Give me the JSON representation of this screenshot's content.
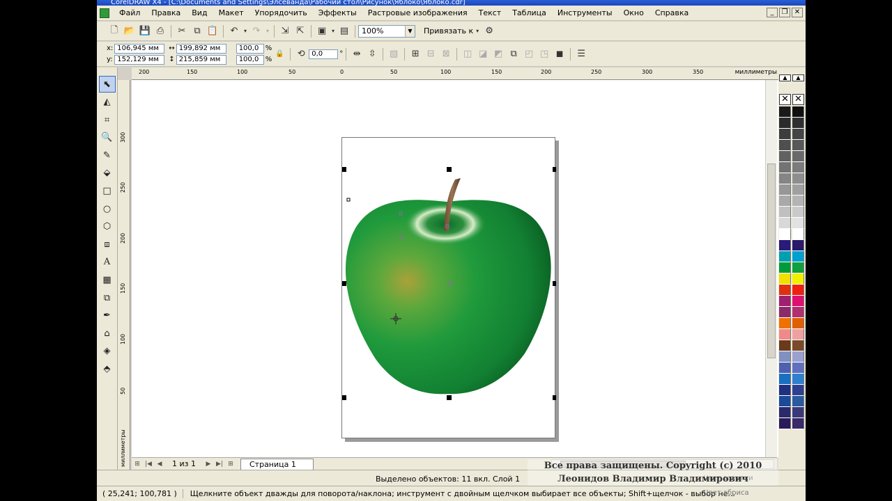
{
  "window": {
    "title": "CorelDRAW X4 - [C:\\Documents and Settings\\Элсеванда\\Рабочий стол\\Рисунок\\Яблоко\\Яблоко.cdr]"
  },
  "menu": [
    "Файл",
    "Правка",
    "Вид",
    "Макет",
    "Упорядочить",
    "Эффекты",
    "Растровые изображения",
    "Текст",
    "Таблица",
    "Инструменты",
    "Окно",
    "Справка"
  ],
  "toolbar": {
    "zoom": "100%",
    "snap_label": "Привязать к"
  },
  "properties": {
    "x_label": "x:",
    "x": "106,945 мм",
    "y_label": "y:",
    "y": "152,129 мм",
    "width": "199,892 мм",
    "height": "215,859 мм",
    "scale_x": "100,0",
    "scale_y": "100,0",
    "percent": "%",
    "rotation": "0,0",
    "degree": "°"
  },
  "ruler": {
    "unit": "миллиметры",
    "h_ticks": [
      "200",
      "150",
      "100",
      "50",
      "0",
      "50",
      "100",
      "150",
      "200",
      "250",
      "300",
      "350"
    ],
    "v_ticks": [
      "300",
      "250",
      "200",
      "150",
      "100",
      "50"
    ],
    "v_unit": "миллиметры"
  },
  "page_nav": {
    "count": "1 из 1",
    "tab": "Страница 1"
  },
  "status": {
    "selection": "Выделено объектов: 11 вкл. Слой 1",
    "coords": "( 25,241; 100,781 )",
    "hint": "Щелкните объект дважды для поворота/наклона; инструмент с двойным щелчком выбирает все объекты; Shift+щелчок - выбор не...",
    "fill_label": "Цвет заливки",
    "outline_label": "Цвет абриса"
  },
  "watermark": {
    "line1": "Все права защищены. Copyright (c) 2010",
    "line2": "Леонидов Владимир Владимирович"
  },
  "palette": {
    "col1": [
      "#1a1a1a",
      "#2b2b2b",
      "#3d3d3d",
      "#4f4f4f",
      "#616161",
      "#737373",
      "#858585",
      "#979797",
      "#a9a9a9",
      "#c0c0c0",
      "#d8d8d8",
      "#ffffff",
      "#2a1a7a",
      "#00a0b0",
      "#009a3a",
      "#f0e000",
      "#e03010",
      "#a02070",
      "#8a2a6a",
      "#f07000",
      "#f08a8a",
      "#6a3a1a",
      "#8090c0",
      "#5060b0",
      "#1a70c0",
      "#203080",
      "#1a4a9a",
      "#2a2a6a",
      "#2a1a5a"
    ],
    "col2": [
      "#101010",
      "#303030",
      "#454545",
      "#585858",
      "#6a6a6a",
      "#7c7c7c",
      "#8e8e8e",
      "#a0a0a0",
      "#b4b4b4",
      "#cacaca",
      "#e2e2e2",
      "#ffffff",
      "#2a1a6a",
      "#00a0d0",
      "#10a040",
      "#f0f000",
      "#f02010",
      "#e01070",
      "#b03070",
      "#e06000",
      "#f0a0a0",
      "#7a4a2a",
      "#9aa0d0",
      "#6070c0",
      "#3080d0",
      "#304090",
      "#2a5aa0",
      "#3a3a7a",
      "#3a2a6a"
    ]
  }
}
